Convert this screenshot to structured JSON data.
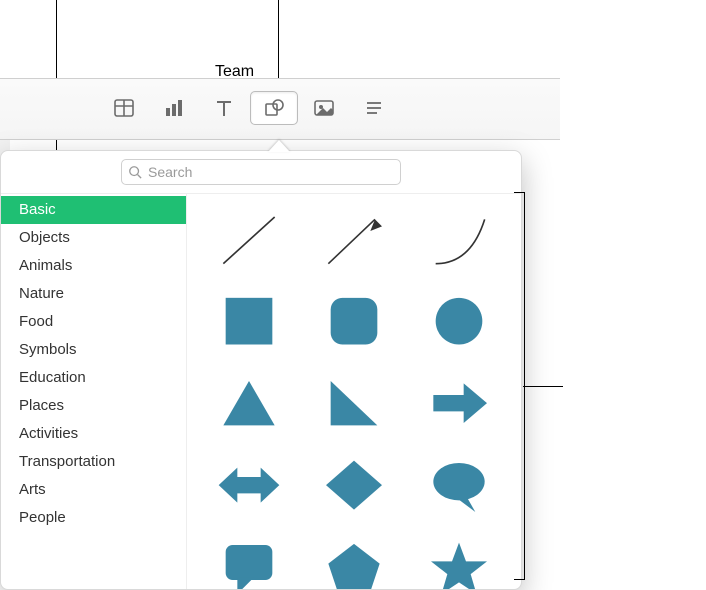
{
  "header": {
    "team_label": "Team"
  },
  "toolbar": {
    "items": [
      {
        "name": "table-tool",
        "selected": false
      },
      {
        "name": "chart-tool",
        "selected": false
      },
      {
        "name": "text-tool",
        "selected": false
      },
      {
        "name": "shape-tool",
        "selected": true
      },
      {
        "name": "media-tool",
        "selected": false
      },
      {
        "name": "comment-tool",
        "selected": false
      }
    ]
  },
  "search": {
    "placeholder": "Search",
    "value": ""
  },
  "sidebar": {
    "items": [
      {
        "label": "Basic",
        "selected": true
      },
      {
        "label": "Objects",
        "selected": false
      },
      {
        "label": "Animals",
        "selected": false
      },
      {
        "label": "Nature",
        "selected": false
      },
      {
        "label": "Food",
        "selected": false
      },
      {
        "label": "Symbols",
        "selected": false
      },
      {
        "label": "Education",
        "selected": false
      },
      {
        "label": "Places",
        "selected": false
      },
      {
        "label": "Activities",
        "selected": false
      },
      {
        "label": "Transportation",
        "selected": false
      },
      {
        "label": "Arts",
        "selected": false
      },
      {
        "label": "People",
        "selected": false
      }
    ]
  },
  "shapes": {
    "items": [
      {
        "name": "line"
      },
      {
        "name": "arrow-line"
      },
      {
        "name": "curve"
      },
      {
        "name": "square"
      },
      {
        "name": "rounded-square"
      },
      {
        "name": "circle"
      },
      {
        "name": "triangle"
      },
      {
        "name": "right-triangle"
      },
      {
        "name": "arrow-right"
      },
      {
        "name": "arrow-double"
      },
      {
        "name": "diamond"
      },
      {
        "name": "speech-bubble"
      },
      {
        "name": "callout-square"
      },
      {
        "name": "pentagon"
      },
      {
        "name": "star"
      }
    ]
  },
  "colors": {
    "accent": "#1fbf73",
    "shape_fill": "#3a87a5"
  }
}
